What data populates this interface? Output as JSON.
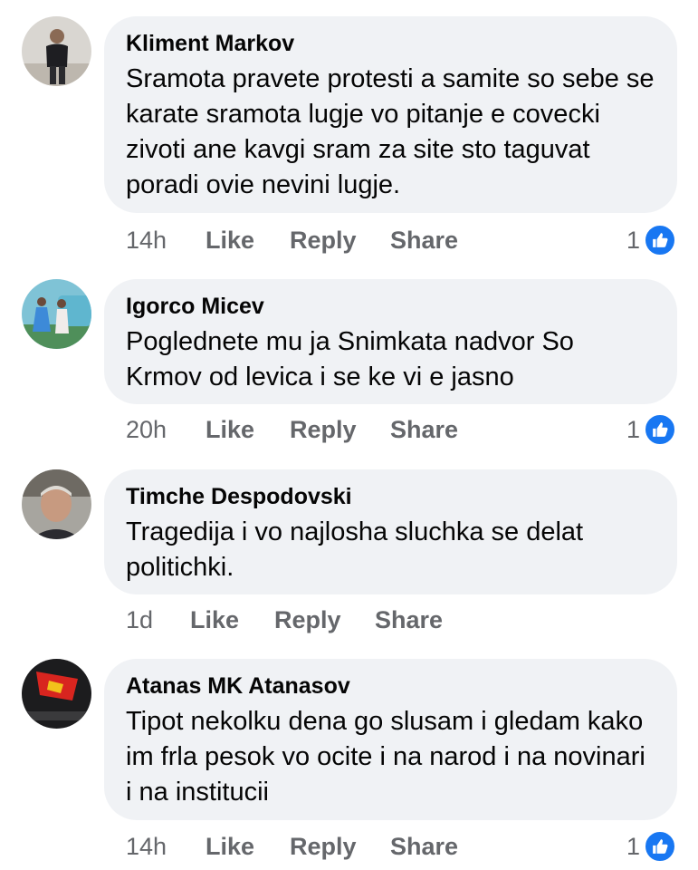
{
  "colors": {
    "bubble": "#f0f2f5",
    "meta_text": "#65676b",
    "like_blue": "#1877f2"
  },
  "actions": {
    "like": "Like",
    "reply": "Reply",
    "share": "Share"
  },
  "comments": [
    {
      "author": "Kliment Markov",
      "text": "Sramota pravete protesti a samite so sebe se karate sramota lugje vo pitanje e covecki zivoti ane kavgi sram za site sto taguvat poradi ovie nevini lugje.",
      "time": "14h",
      "reaction_count": "1",
      "reaction_icon": "like-icon",
      "avatar_icon": "profile-photo-man-standing"
    },
    {
      "author": "Igorco Micev",
      "text": "Poglednete mu ja Snimkata nadvor So Krmov od levica i se ke vi e jasno",
      "time": "20h",
      "reaction_count": "1",
      "reaction_icon": "like-icon",
      "avatar_icon": "profile-photo-group-by-van"
    },
    {
      "author": "Timche Despodovski",
      "text": "Tragedija i vo najlosha sluchka se delat politichki.",
      "time": "1d",
      "reaction_count": "",
      "reaction_icon": "",
      "avatar_icon": "profile-photo-man-portrait"
    },
    {
      "author": "Atanas MK Atanasov",
      "text": "Tipot nekolku dena go slusam i gledam kako im frla pesok vo ocite i na narod i na novinari i na institucii",
      "time": "14h",
      "reaction_count": "1",
      "reaction_icon": "like-icon",
      "avatar_icon": "profile-photo-red-flag"
    }
  ]
}
